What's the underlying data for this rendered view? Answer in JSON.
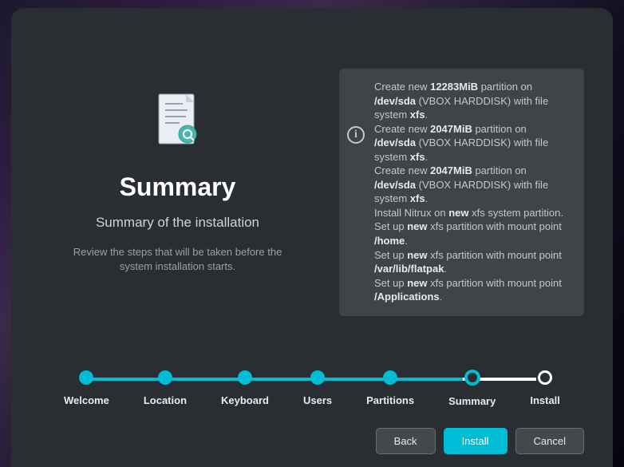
{
  "header": {
    "title": "Summary",
    "subtitle": "Summary of the installation",
    "description": "Review the steps that will be taken before the system installation starts."
  },
  "operations": [
    {
      "prefix": "Create new ",
      "size": "12283MiB",
      "mid": " partition on ",
      "device": "/dev/sda",
      "tail": " (VBOX HARDDISK) with file system ",
      "fs": "xfs",
      "end": "."
    },
    {
      "prefix": "Create new ",
      "size": "2047MiB",
      "mid": " partition on ",
      "device": "/dev/sda",
      "tail": " (VBOX HARDDISK) with file system ",
      "fs": "xfs",
      "end": "."
    },
    {
      "prefix": "Create new ",
      "size": "2047MiB",
      "mid": " partition on ",
      "device": "/dev/sda",
      "tail": " (VBOX HARDDISK) with file system ",
      "fs": "xfs",
      "end": "."
    },
    {
      "prefix": "Install Nitrux on ",
      "size": "new",
      "mid": " xfs system partition.",
      "device": "",
      "tail": "",
      "fs": "",
      "end": ""
    },
    {
      "prefix": "Set up ",
      "size": "new",
      "mid": " xfs partition with mount point ",
      "device": "/home",
      "tail": "",
      "fs": "",
      "end": "."
    },
    {
      "prefix": "Set up ",
      "size": "new",
      "mid": " xfs partition with mount point ",
      "device": "/var/lib/flatpak",
      "tail": "",
      "fs": "",
      "end": "."
    },
    {
      "prefix": "Set up ",
      "size": "new",
      "mid": " xfs partition with mount point ",
      "device": "/Applications",
      "tail": "",
      "fs": "",
      "end": "."
    }
  ],
  "steps": [
    {
      "label": "Welcome",
      "state": "done"
    },
    {
      "label": "Location",
      "state": "done"
    },
    {
      "label": "Keyboard",
      "state": "done"
    },
    {
      "label": "Users",
      "state": "done"
    },
    {
      "label": "Partitions",
      "state": "done"
    },
    {
      "label": "Summary",
      "state": "current"
    },
    {
      "label": "Install",
      "state": "future"
    }
  ],
  "buttons": {
    "back": "Back",
    "install": "Install",
    "cancel": "Cancel"
  }
}
